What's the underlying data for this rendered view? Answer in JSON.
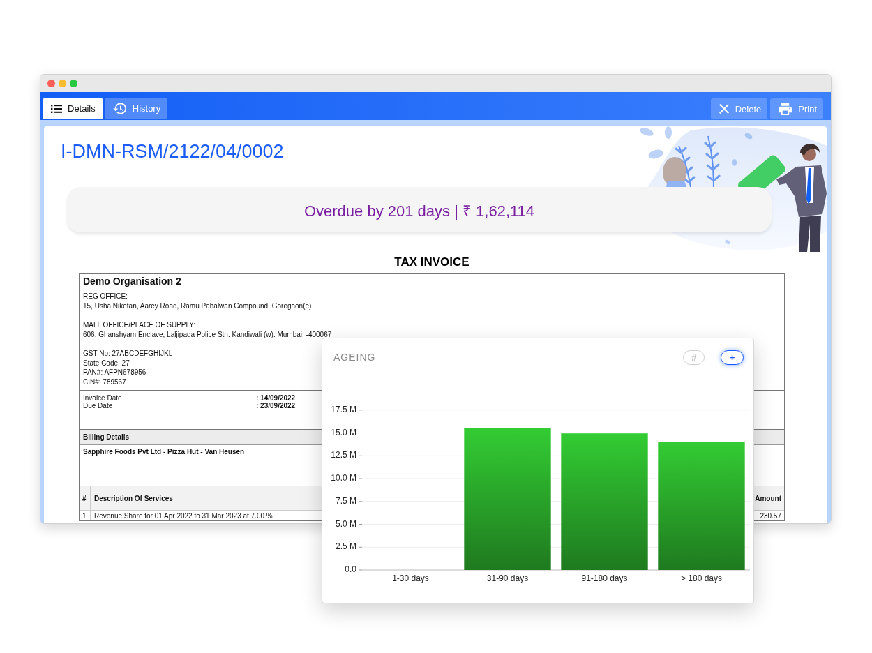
{
  "tabs": [
    {
      "label": "Details",
      "selected": true
    },
    {
      "label": "History",
      "selected": false
    }
  ],
  "actions": [
    {
      "kind": "delete",
      "label": "Delete"
    },
    {
      "kind": "print",
      "label": "Print"
    }
  ],
  "invoice_number": "I-DMN-RSM/2122/04/0002",
  "status_banner": "Overdue by 201 days | ₹ 1,62,114",
  "invoice": {
    "heading": "TAX INVOICE",
    "organisation": "Demo Organisation 2",
    "offices": [
      {
        "label": "REG OFFICE:",
        "address": "15, Usha Niketan, Aarey Road, Ramu Pahalwan Compound, Goregaon(e)"
      },
      {
        "label": "MALL OFFICE/PLACE OF SUPPLY:",
        "address": "606, Ghanshyam Enclave, Laljipada Police Stn. Kandiwali (w). Mumbai: -400067"
      }
    ],
    "registration": [
      "GST No: 27ABCDEFGHIJKL",
      "State Code: 27",
      "PAN#: AFPN678956",
      "CIN#: 789567"
    ],
    "dates": [
      {
        "label": "Invoice Date",
        "value": ": 14/09/2022"
      },
      {
        "label": "Due Date",
        "value": ": 23/09/2022"
      }
    ],
    "billing_heading": "Billing Details",
    "billing_party": "Sapphire Foods Pvt Ltd - Pizza Hut - Van Heusen",
    "services": {
      "columns": [
        "#",
        "Description Of Services",
        "Amount"
      ],
      "rows": [
        [
          "1",
          "Revenue Share for 01 Apr 2022 to 31 Mar 2023 at 7.00 %",
          "230.57"
        ]
      ]
    }
  },
  "ageing_card": {
    "title": "AGEING",
    "toggles": [
      {
        "label": "#",
        "selected": false
      },
      {
        "label": "+",
        "selected": true
      }
    ],
    "chart_data": {
      "type": "bar",
      "grid": true,
      "categories": [
        "1-30 days",
        "31-90 days",
        "91-180 days",
        "> 180 days"
      ],
      "series": [
        {
          "color": "#33cc33",
          "values": [
            0,
            15.5,
            14.95,
            14.05
          ]
        }
      ],
      "ylim": [
        0,
        17.5
      ],
      "yticks": [
        {
          "value": 0,
          "label": "0.0"
        },
        {
          "value": 2.5,
          "label": "2.5 M"
        },
        {
          "value": 5,
          "label": "5.0 M"
        },
        {
          "value": 7.5,
          "label": "7.5 M"
        },
        {
          "value": 10,
          "label": "10.0 M"
        },
        {
          "value": 12.5,
          "label": "12.5 M"
        },
        {
          "value": 15,
          "label": "15.0 M"
        },
        {
          "value": 17.5,
          "label": "17.5 M"
        }
      ]
    }
  }
}
